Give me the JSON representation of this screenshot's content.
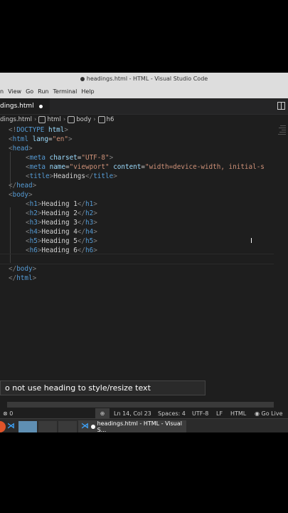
{
  "window": {
    "title": "headings.html - HTML - Visual Studio Code"
  },
  "menu": {
    "items": [
      "n",
      "View",
      "Go",
      "Run",
      "Terminal",
      "Help"
    ]
  },
  "tab": {
    "label": "dings.html"
  },
  "breadcrumb": {
    "file": "dings.html",
    "html": "html",
    "body": "body",
    "h6": "h6"
  },
  "code": {
    "l1": {
      "a": "<!",
      "b": "DOCTYPE",
      "c": " html",
      "d": ">"
    },
    "l2": {
      "a": "<",
      "b": "html",
      "c": " lang",
      "d": "=",
      "e": "\"en\"",
      "f": ">"
    },
    "l3": {
      "a": "<",
      "b": "head",
      "c": ">"
    },
    "l4": {
      "a": "<",
      "b": "meta",
      "c": " charset",
      "d": "=",
      "e": "\"UTF-8\"",
      "f": ">"
    },
    "l5": {
      "a": "<",
      "b": "meta",
      "c": " name",
      "d": "=",
      "e": "\"viewport\"",
      "f": " content",
      "g": "=",
      "h": "\"width=device-width, initial-s"
    },
    "l6": {
      "a": "<",
      "b": "title",
      "c": ">",
      "d": "Headings",
      "e": "</",
      "f": "title",
      "g": ">"
    },
    "l7": {
      "a": "</",
      "b": "head",
      "c": ">"
    },
    "l8": {
      "a": "<",
      "b": "body",
      "c": ">"
    },
    "headings": [
      {
        "open": "h1",
        "text": "Heading 1"
      },
      {
        "open": "h2",
        "text": "Heading 2"
      },
      {
        "open": "h3",
        "text": "Heading 3"
      },
      {
        "open": "h4",
        "text": "Heading 4"
      },
      {
        "open": "h5",
        "text": "Heading 5"
      },
      {
        "open": "h6",
        "text": "Heading 6"
      }
    ],
    "l16": {
      "a": "</",
      "b": "body",
      "c": ">"
    },
    "l17": {
      "a": "</",
      "b": "html",
      "c": ">"
    }
  },
  "caption": {
    "text": "o not use heading to style/resize text"
  },
  "status": {
    "problems": "0",
    "position": "Ln 14, Col 23",
    "spaces": "Spaces: 4",
    "encoding": "UTF-8",
    "eol": "LF",
    "language": "HTML",
    "golive": "Go Live"
  },
  "taskbar": {
    "window_title": "headings.html - HTML - Visual S..."
  },
  "colors": {
    "editor_bg": "#1e1e1e",
    "tag": "#569cd6",
    "attribute": "#9cdcfe",
    "string": "#ce9178",
    "bracket": "#808080"
  }
}
